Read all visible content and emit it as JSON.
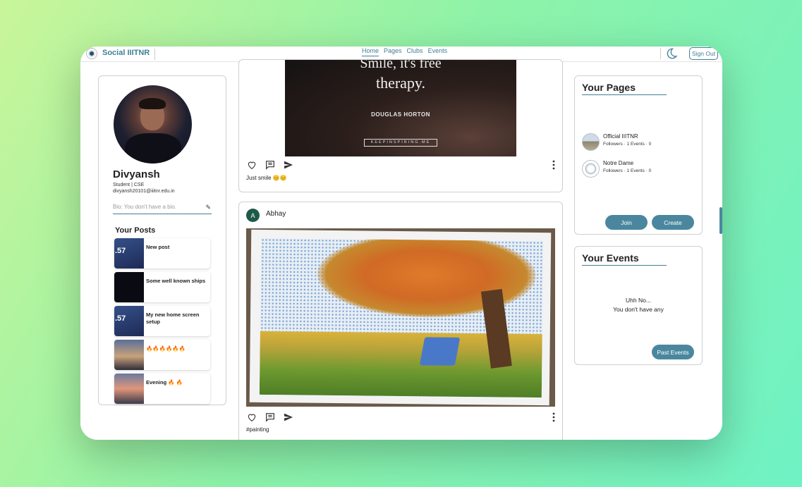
{
  "navbar": {
    "brand": "Social IIITNR",
    "links": [
      "Home",
      "Pages",
      "Clubs",
      "Events"
    ],
    "active_link": "Home",
    "sign_out": "Sign Out"
  },
  "profile": {
    "name": "Divyansh",
    "role": "Student | CSE",
    "email": "divyansh20101@iiitnr.edu.in",
    "bio_placeholder": "Bio: You don't have a bio.",
    "posts_title": "Your Posts",
    "posts": [
      {
        "label": "New post",
        "thumb_text": ".57"
      },
      {
        "label": "Some well known ships",
        "thumb_text": ""
      },
      {
        "label": "My new home screen setup",
        "thumb_text": ".57"
      },
      {
        "label": "🔥🔥🔥🔥🔥🔥",
        "thumb_text": ""
      },
      {
        "label": "Evening 🔥 🔥",
        "thumb_text": ""
      }
    ]
  },
  "feed": {
    "post1": {
      "quote_line1": "Smile, it's free",
      "quote_line2": "therapy.",
      "quote_author": "DOUGLAS HORTON",
      "quote_tag": "KEEPINSPIRING.ME",
      "caption": "Just smile 😊😊"
    },
    "post2": {
      "author_initial": "A",
      "author": "Abhay",
      "caption": "#painting"
    }
  },
  "your_pages": {
    "title": "Your Pages",
    "pages": [
      {
        "name": "Official IIITNR",
        "meta": "Followers · 1   Events · 0"
      },
      {
        "name": "Notre Dame",
        "meta": "Followers · 1   Events · 0"
      }
    ],
    "join": "Join",
    "create": "Create"
  },
  "your_events": {
    "title": "Your Events",
    "empty_line1": "Uhh No...",
    "empty_line2": "You don't have any",
    "past_events": "Past Events"
  },
  "colors": {
    "accent": "#3f7f95",
    "button": "#4a879f"
  }
}
